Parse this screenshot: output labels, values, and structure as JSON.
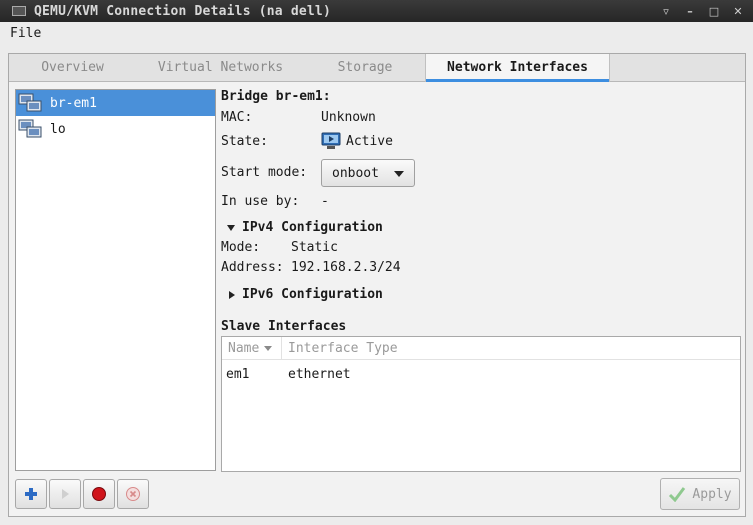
{
  "window": {
    "title": "QEMU/KVM Connection Details (na dell)",
    "controls": [
      "▿",
      "–",
      "□",
      "✕"
    ]
  },
  "menu": {
    "file": "File"
  },
  "tabs": [
    {
      "label": "Overview",
      "active": false
    },
    {
      "label": "Virtual Networks",
      "active": false
    },
    {
      "label": "Storage",
      "active": false
    },
    {
      "label": "Network Interfaces",
      "active": true
    }
  ],
  "interfaces": [
    {
      "name": "br-em1",
      "selected": true
    },
    {
      "name": "lo",
      "selected": false
    }
  ],
  "details": {
    "header": "Bridge br-em1:",
    "mac_label": "MAC:",
    "mac_value": "Unknown",
    "state_label": "State:",
    "state_value": "Active",
    "start_mode_label": "Start mode:",
    "start_mode_value": "onboot",
    "in_use_label": "In use by:",
    "in_use_value": "-",
    "ipv4_header": "IPv4 Configuration",
    "ipv4_mode_label": "Mode:",
    "ipv4_mode_value": "Static",
    "ipv4_address_label": "Address:",
    "ipv4_address_value": "192.168.2.3/24",
    "ipv6_header": "IPv6 Configuration",
    "slave_header": "Slave Interfaces"
  },
  "slave_table": {
    "columns": [
      "Name",
      "Interface Type"
    ],
    "rows": [
      {
        "name": "em1",
        "type": "ethernet"
      }
    ]
  },
  "buttons": {
    "apply": "Apply"
  },
  "colors": {
    "accent": "#4a90d9",
    "stop_red": "#d0141b"
  }
}
